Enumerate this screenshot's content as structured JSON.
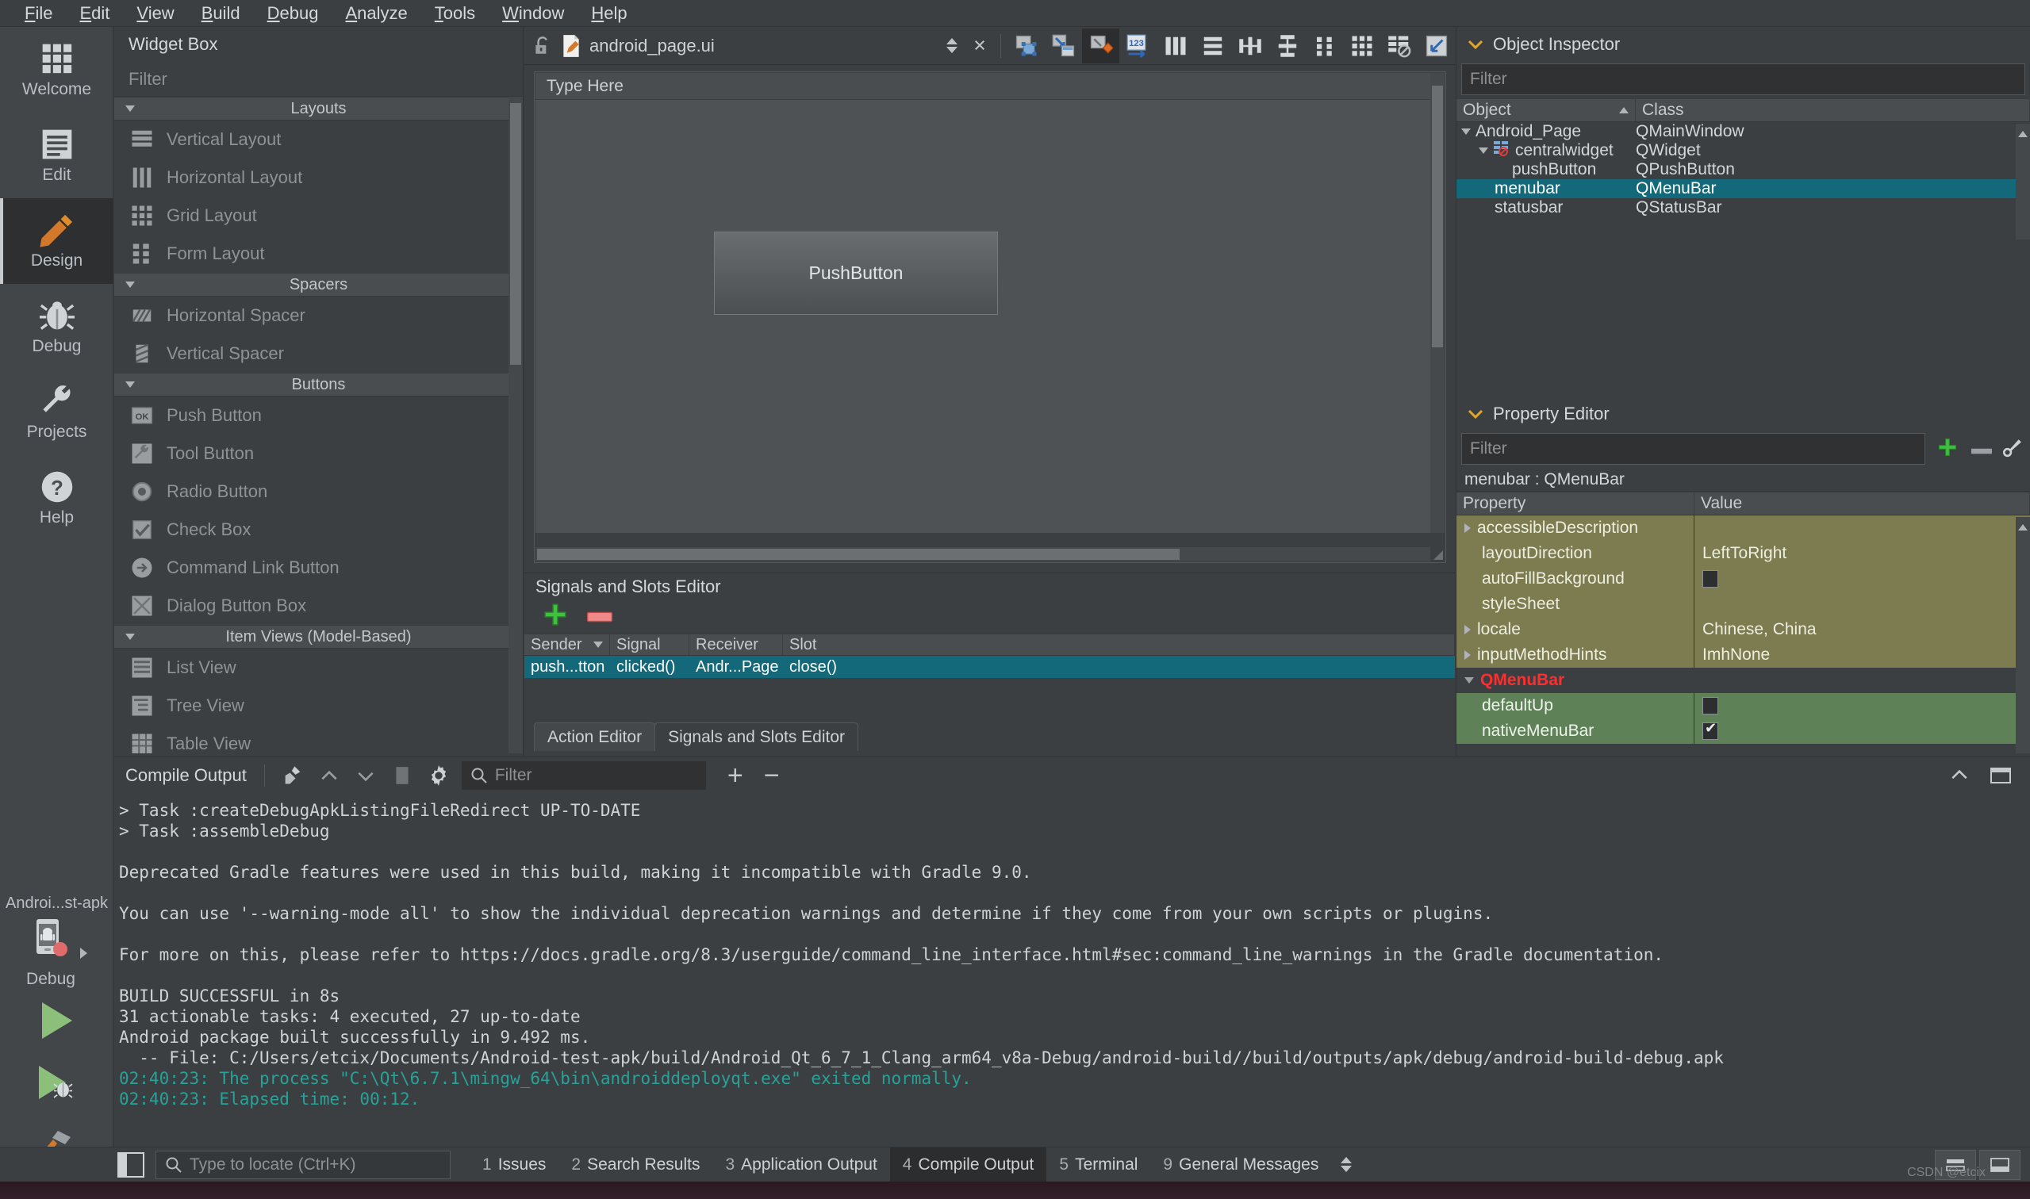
{
  "menubar": {
    "items": [
      {
        "label": "File",
        "mnemonic": "F"
      },
      {
        "label": "Edit",
        "mnemonic": "E"
      },
      {
        "label": "View",
        "mnemonic": "V"
      },
      {
        "label": "Build",
        "mnemonic": "B"
      },
      {
        "label": "Debug",
        "mnemonic": "D"
      },
      {
        "label": "Analyze",
        "mnemonic": "A"
      },
      {
        "label": "Tools",
        "mnemonic": "T"
      },
      {
        "label": "Window",
        "mnemonic": "W"
      },
      {
        "label": "Help",
        "mnemonic": "H"
      }
    ]
  },
  "modebar": {
    "modes": [
      {
        "label": "Welcome",
        "icon": "grid-icon",
        "active": false
      },
      {
        "label": "Edit",
        "icon": "document-lines-icon",
        "active": false
      },
      {
        "label": "Design",
        "icon": "pencil-icon",
        "active": true
      },
      {
        "label": "Debug",
        "icon": "bug-icon",
        "active": false
      },
      {
        "label": "Projects",
        "icon": "wrench-icon",
        "active": false
      },
      {
        "label": "Help",
        "icon": "question-mark-icon",
        "active": false
      }
    ],
    "kit": {
      "project_name": "Androi...st-apk",
      "build_config": "Debug",
      "device_icon": "android-device-icon",
      "run_label": "Run",
      "debug_label": "Start Debugging",
      "build_label": "Build Project"
    }
  },
  "widget_box": {
    "title": "Widget Box",
    "filter_placeholder": "Filter",
    "groups": [
      {
        "name": "Layouts",
        "items": [
          {
            "label": "Vertical Layout",
            "icon": "vertical-layout-icon"
          },
          {
            "label": "Horizontal Layout",
            "icon": "horizontal-layout-icon"
          },
          {
            "label": "Grid Layout",
            "icon": "grid-layout-icon"
          },
          {
            "label": "Form Layout",
            "icon": "form-layout-icon"
          }
        ]
      },
      {
        "name": "Spacers",
        "items": [
          {
            "label": "Horizontal Spacer",
            "icon": "horizontal-spacer-icon"
          },
          {
            "label": "Vertical Spacer",
            "icon": "vertical-spacer-icon"
          }
        ]
      },
      {
        "name": "Buttons",
        "items": [
          {
            "label": "Push Button",
            "icon": "push-button-icon"
          },
          {
            "label": "Tool Button",
            "icon": "tool-button-icon"
          },
          {
            "label": "Radio Button",
            "icon": "radio-button-icon"
          },
          {
            "label": "Check Box",
            "icon": "check-box-icon"
          },
          {
            "label": "Command Link Button",
            "icon": "command-link-button-icon"
          },
          {
            "label": "Dialog Button Box",
            "icon": "dialog-button-box-icon"
          }
        ]
      },
      {
        "name": "Item Views (Model-Based)",
        "items": [
          {
            "label": "List View",
            "icon": "list-view-icon"
          },
          {
            "label": "Tree View",
            "icon": "tree-view-icon"
          },
          {
            "label": "Table View",
            "icon": "table-view-icon"
          }
        ]
      }
    ]
  },
  "form_editor": {
    "lock_icon": "unlocked-padlock-icon",
    "file_icon": "ui-file-icon",
    "filename": "android_page.ui",
    "close_label": "×",
    "toolbar_buttons": [
      {
        "name": "edit-widgets",
        "tooltip": "Edit Widgets",
        "active": false
      },
      {
        "name": "edit-signals-slots-disconnect",
        "tooltip": "Edit Signals/Slots",
        "active": false
      },
      {
        "name": "edit-signals-slots",
        "tooltip": "Edit Signals/Slots",
        "active": true
      },
      {
        "name": "edit-tab-order",
        "tooltip": "Edit Tab Order",
        "active": false
      },
      {
        "name": "layout-horizontally",
        "tooltip": "Lay Out Horizontally",
        "active": false
      },
      {
        "name": "layout-vertically",
        "tooltip": "Lay Out Vertically",
        "active": false
      },
      {
        "name": "layout-horizontally-in-splitter",
        "tooltip": "Lay Out Horizontally in Splitter",
        "active": false
      },
      {
        "name": "layout-vertically-in-splitter",
        "tooltip": "Lay Out Vertically in Splitter",
        "active": false
      },
      {
        "name": "layout-in-form-layout",
        "tooltip": "Lay Out in a Form Layout",
        "active": false
      },
      {
        "name": "layout-in-grid",
        "tooltip": "Lay Out in a Grid",
        "active": false
      },
      {
        "name": "break-layout",
        "tooltip": "Break Layout",
        "active": false
      },
      {
        "name": "adjust-size",
        "tooltip": "Adjust Size",
        "active": false
      }
    ],
    "canvas": {
      "menu_placeholder": "Type Here",
      "pushbutton_text": "PushButton"
    }
  },
  "signals_slots": {
    "title": "Signals and Slots Editor",
    "add_label": "+",
    "remove_label": "−",
    "columns": [
      "Sender",
      "Signal",
      "Receiver",
      "Slot"
    ],
    "rows": [
      {
        "sender": "push...tton",
        "signal": "clicked()",
        "receiver": "Andr...Page",
        "slot": "close()",
        "selected": true
      }
    ],
    "tabs": [
      {
        "label": "Action Editor",
        "active": false
      },
      {
        "label": "Signals and Slots Editor",
        "active": true
      }
    ]
  },
  "object_inspector": {
    "title": "Object Inspector",
    "filter_placeholder": "Filter",
    "columns": [
      "Object",
      "Class"
    ],
    "rows": [
      {
        "object": "Android_Page",
        "class": "QMainWindow",
        "depth": 0,
        "expander": "down",
        "icon": "",
        "selected": false
      },
      {
        "object": "centralwidget",
        "class": "QWidget",
        "depth": 1,
        "expander": "down",
        "icon": "no-layout-icon",
        "selected": false
      },
      {
        "object": "pushButton",
        "class": "QPushButton",
        "depth": 2,
        "expander": "none",
        "icon": "",
        "selected": false
      },
      {
        "object": "menubar",
        "class": "QMenuBar",
        "depth": 1,
        "expander": "none",
        "icon": "",
        "selected": true
      },
      {
        "object": "statusbar",
        "class": "QStatusBar",
        "depth": 1,
        "expander": "none",
        "icon": "",
        "selected": false
      }
    ]
  },
  "property_editor": {
    "title": "Property Editor",
    "filter_placeholder": "Filter",
    "add_label": "+",
    "remove_label": "−",
    "config_icon": "wrench-icon",
    "selected_object": "menubar : QMenuBar",
    "columns": [
      "Property",
      "Value"
    ],
    "rows": [
      {
        "property": "accessibleDescription",
        "value": "",
        "kind": "olive",
        "expander": true
      },
      {
        "property": "layoutDirection",
        "value": "LeftToRight",
        "kind": "olive",
        "expander": false
      },
      {
        "property": "autoFillBackground",
        "value": "",
        "kind": "olive",
        "expander": false,
        "checkbox": false
      },
      {
        "property": "styleSheet",
        "value": "",
        "kind": "olive",
        "expander": false
      },
      {
        "property": "locale",
        "value": "Chinese, China",
        "kind": "olive",
        "expander": true
      },
      {
        "property": "inputMethodHints",
        "value": "ImhNone",
        "kind": "olive",
        "expander": true
      },
      {
        "property": "QMenuBar",
        "value": "",
        "kind": "group",
        "expander": true
      },
      {
        "property": "defaultUp",
        "value": "",
        "kind": "green",
        "expander": false,
        "checkbox": false
      },
      {
        "property": "nativeMenuBar",
        "value": "",
        "kind": "green",
        "expander": false,
        "checkbox": true
      }
    ]
  },
  "compile_output": {
    "title": "Compile Output",
    "filter_placeholder": "Filter",
    "buttons": [
      {
        "name": "clear-output",
        "icon": "broom-icon"
      },
      {
        "name": "previous-item",
        "icon": "chevron-up-icon"
      },
      {
        "name": "next-item",
        "icon": "chevron-down-icon"
      },
      {
        "name": "stop",
        "icon": "stop-square-icon"
      },
      {
        "name": "settings",
        "icon": "gear-icon"
      }
    ],
    "zoom_in_label": "+",
    "zoom_out_label": "−",
    "maximize_icon": "chevron-up-icon",
    "close_icon": "window-icon",
    "lines": [
      {
        "text": "> Task :createDebugApkListingFileRedirect UP-TO-DATE",
        "style": "normal"
      },
      {
        "text": "> Task :assembleDebug",
        "style": "normal"
      },
      {
        "text": "",
        "style": "normal"
      },
      {
        "text": "Deprecated Gradle features were used in this build, making it incompatible with Gradle 9.0.",
        "style": "normal"
      },
      {
        "text": "",
        "style": "normal"
      },
      {
        "text": "You can use '--warning-mode all' to show the individual deprecation warnings and determine if they come from your own scripts or plugins.",
        "style": "normal"
      },
      {
        "text": "",
        "style": "normal"
      },
      {
        "text": "For more on this, please refer to https://docs.gradle.org/8.3/userguide/command_line_interface.html#sec:command_line_warnings in the Gradle documentation.",
        "style": "normal"
      },
      {
        "text": "",
        "style": "normal"
      },
      {
        "text": "BUILD SUCCESSFUL in 8s",
        "style": "normal"
      },
      {
        "text": "31 actionable tasks: 4 executed, 27 up-to-date",
        "style": "normal"
      },
      {
        "text": "Android package built successfully in 9.492 ms.",
        "style": "normal"
      },
      {
        "text": "  -- File: C:/Users/etcix/Documents/Android-test-apk/build/Android_Qt_6_7_1_Clang_arm64_v8a-Debug/android-build//build/outputs/apk/debug/android-build-debug.apk",
        "style": "normal"
      },
      {
        "text": "02:40:23: The process \"C:\\Qt\\6.7.1\\mingw_64\\bin\\androiddeployqt.exe\" exited normally.",
        "style": "teal"
      },
      {
        "text": "02:40:23: Elapsed time: 00:12.",
        "style": "teal"
      }
    ]
  },
  "status_bar": {
    "sidebar_toggle_icon": "panel-toggle-icon",
    "locate_placeholder": "Type to locate (Ctrl+K)",
    "search_icon": "search-icon",
    "tabs": [
      {
        "num": "1",
        "label": "Issues",
        "active": false
      },
      {
        "num": "2",
        "label": "Search Results",
        "active": false
      },
      {
        "num": "3",
        "label": "Application Output",
        "active": false
      },
      {
        "num": "4",
        "label": "Compile Output",
        "active": true
      },
      {
        "num": "5",
        "label": "Terminal",
        "active": false
      },
      {
        "num": "9",
        "label": "General Messages",
        "active": false
      }
    ],
    "spin_icon": "updown-spinner-icon",
    "right_buttons": [
      {
        "name": "toggle-progress-details",
        "icon": "progress-icon"
      },
      {
        "name": "toggle-output-pane",
        "icon": "output-pane-icon"
      }
    ]
  },
  "watermark": {
    "text": "CSDN @etcix"
  },
  "colors": {
    "accent_orange": "#d4792a",
    "selection_teal": "#13697a",
    "property_olive": "#7d7c51",
    "property_green": "#5f8158",
    "group_red": "#ff2e2e",
    "log_teal": "#2aa198",
    "panel_bg": "#3c3f41",
    "canvas_bg": "#4f5255"
  }
}
